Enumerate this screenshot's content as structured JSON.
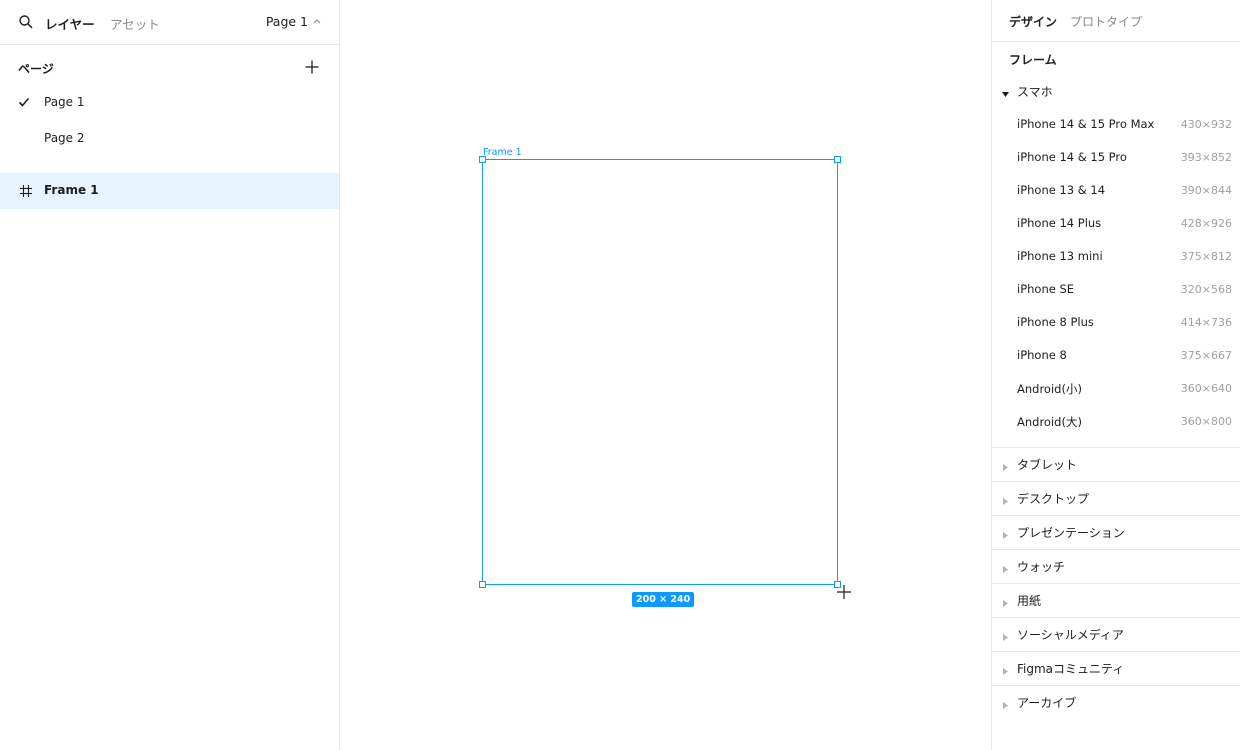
{
  "left_panel": {
    "tabs": {
      "layers": "レイヤー",
      "assets": "アセット"
    },
    "page_selector": "Page 1",
    "pages_title": "ページ",
    "pages": [
      {
        "label": "Page 1",
        "selected": true
      },
      {
        "label": "Page 2",
        "selected": false
      }
    ],
    "layers": [
      {
        "label": "Frame 1",
        "icon": "frame-icon"
      }
    ]
  },
  "canvas": {
    "frame_name": "Frame 1",
    "size_badge": "200 × 240",
    "accent": "#0d99ff"
  },
  "right_panel": {
    "tabs": {
      "design": "デザイン",
      "prototype": "プロトタイプ"
    },
    "section_title": "フレーム",
    "expanded_group": "スマホ",
    "devices": [
      {
        "name": "iPhone 14 & 15 Pro Max",
        "size": "430×932"
      },
      {
        "name": "iPhone 14 & 15 Pro",
        "size": "393×852"
      },
      {
        "name": "iPhone 13 & 14",
        "size": "390×844"
      },
      {
        "name": "iPhone 14 Plus",
        "size": "428×926"
      },
      {
        "name": "iPhone 13 mini",
        "size": "375×812"
      },
      {
        "name": "iPhone SE",
        "size": "320×568"
      },
      {
        "name": "iPhone 8 Plus",
        "size": "414×736"
      },
      {
        "name": "iPhone 8",
        "size": "375×667"
      },
      {
        "name": "Android(小)",
        "size": "360×640"
      },
      {
        "name": "Android(大)",
        "size": "360×800"
      }
    ],
    "categories": [
      "タブレット",
      "デスクトップ",
      "プレゼンテーション",
      "ウォッチ",
      "用紙",
      "ソーシャルメディア",
      "Figmaコミュニティ",
      "アーカイブ"
    ]
  }
}
